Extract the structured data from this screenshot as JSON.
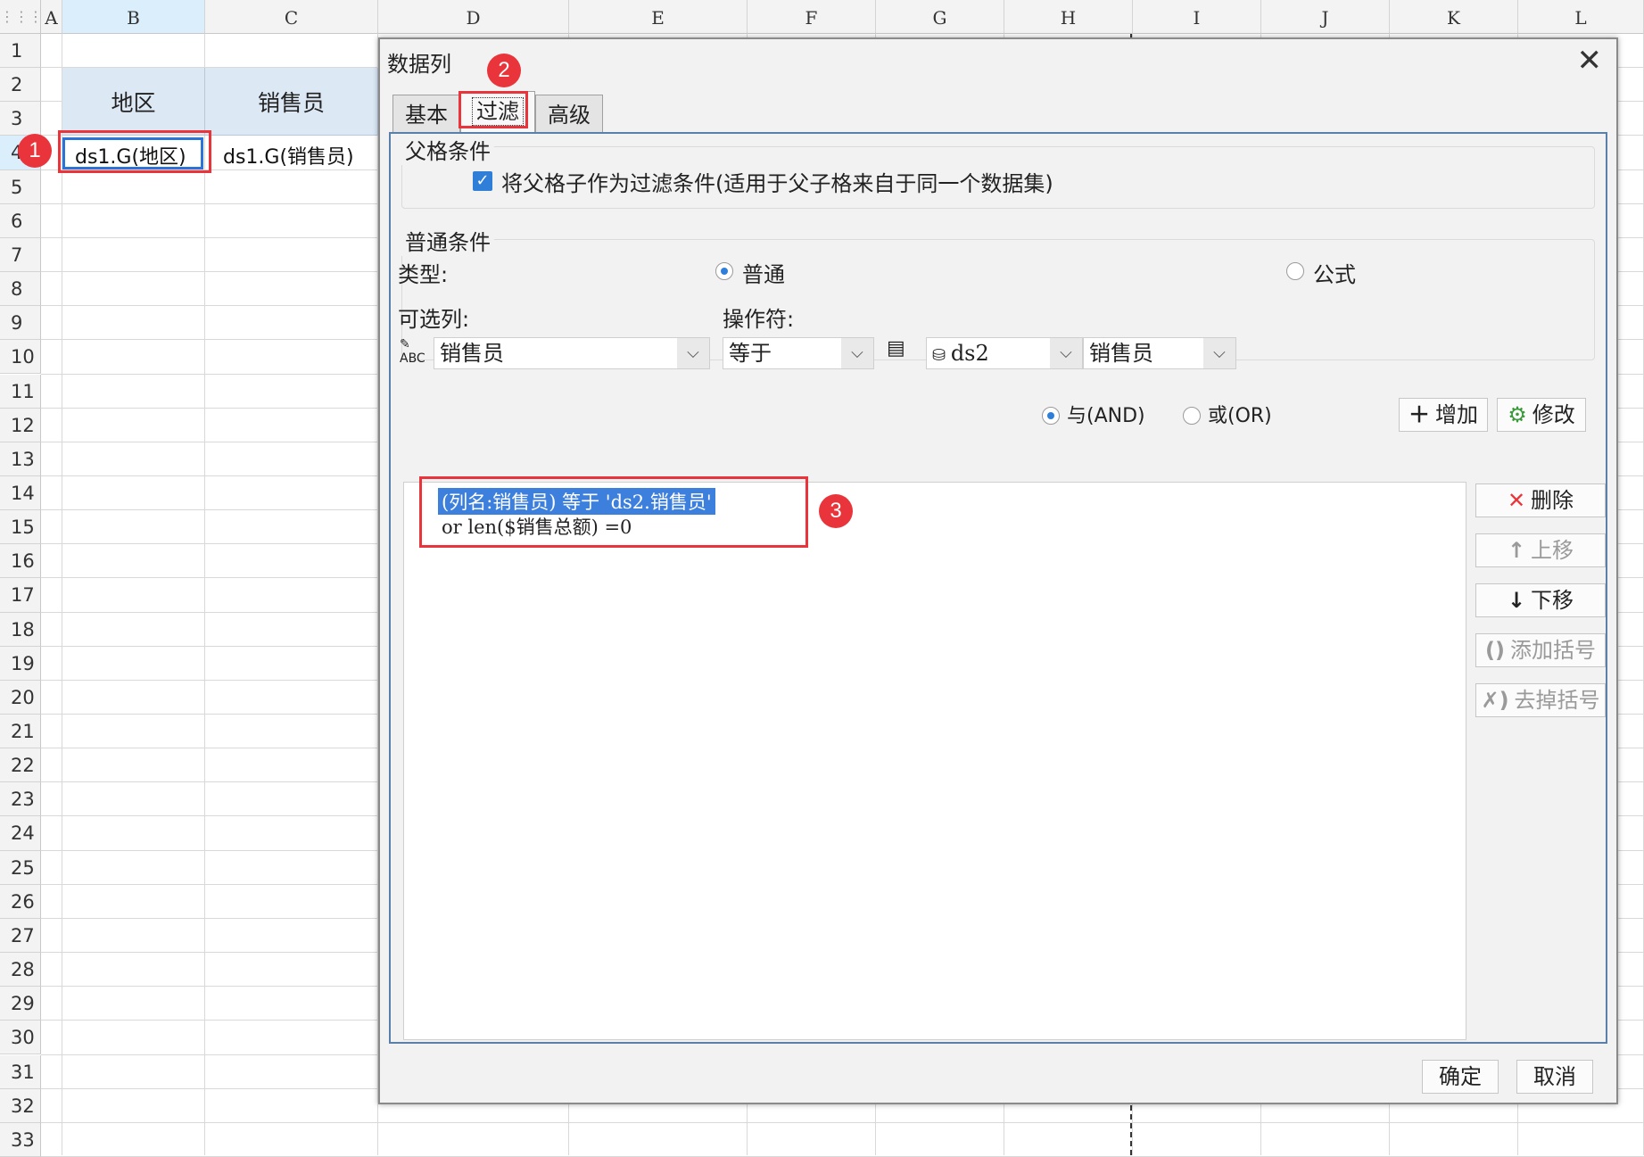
{
  "sheet": {
    "corner_icon": "grid-icon",
    "columns": [
      "A",
      "B",
      "C",
      "D",
      "E",
      "F",
      "G",
      "H",
      "I",
      "J",
      "K",
      "L"
    ],
    "rows": [
      "1",
      "2",
      "3",
      "4",
      "5",
      "6",
      "7",
      "8",
      "9",
      "10",
      "11",
      "12",
      "13",
      "14",
      "15",
      "16",
      "17",
      "18",
      "19",
      "20",
      "21",
      "22",
      "23",
      "24",
      "25",
      "26",
      "27",
      "28",
      "29",
      "30",
      "31",
      "32",
      "33"
    ],
    "header_cells": {
      "region": "地区",
      "salesperson": "销售员"
    },
    "data_cells": {
      "b4": "ds1.G(地区)",
      "c4": "ds1.G(销售员)"
    }
  },
  "annotations": {
    "badge1": "1",
    "badge2": "2",
    "badge3": "3",
    "color": "#e8343a"
  },
  "dialog": {
    "title": "数据列",
    "tabs": [
      "基本",
      "过滤",
      "高级"
    ],
    "active_tab": "过滤",
    "parent": {
      "title": "父格条件",
      "checkbox_label": "将父格子作为过滤条件(适用于父子格来自于同一个数据集)",
      "checked": true
    },
    "normal": {
      "title": "普通条件",
      "type_label": "类型:",
      "type_options": [
        "普通",
        "公式"
      ],
      "type_selected": "普通",
      "column_label": "可选列:",
      "operator_label": "操作符:",
      "column_value": "销售员",
      "operator_value": "等于",
      "dataset_value": "ds2",
      "field_value": "销售员",
      "logic_options": [
        "与(AND)",
        "或(OR)"
      ],
      "logic_selected": "与(AND)",
      "add_button": "增加",
      "modify_button": "修改"
    },
    "conditions": [
      "(列名:销售员) 等于 'ds2.销售员'",
      "or  len($销售总额) =0"
    ],
    "side_buttons": {
      "delete": "删除",
      "move_up": "上移",
      "move_down": "下移",
      "add_bracket": "添加括号",
      "remove_bracket": "去掉括号"
    },
    "ok": "确定",
    "cancel": "取消"
  },
  "colors": {
    "accent": "#2f7fd8",
    "header_fill": "#dde8f5",
    "selected_header": "#dbeefb"
  }
}
